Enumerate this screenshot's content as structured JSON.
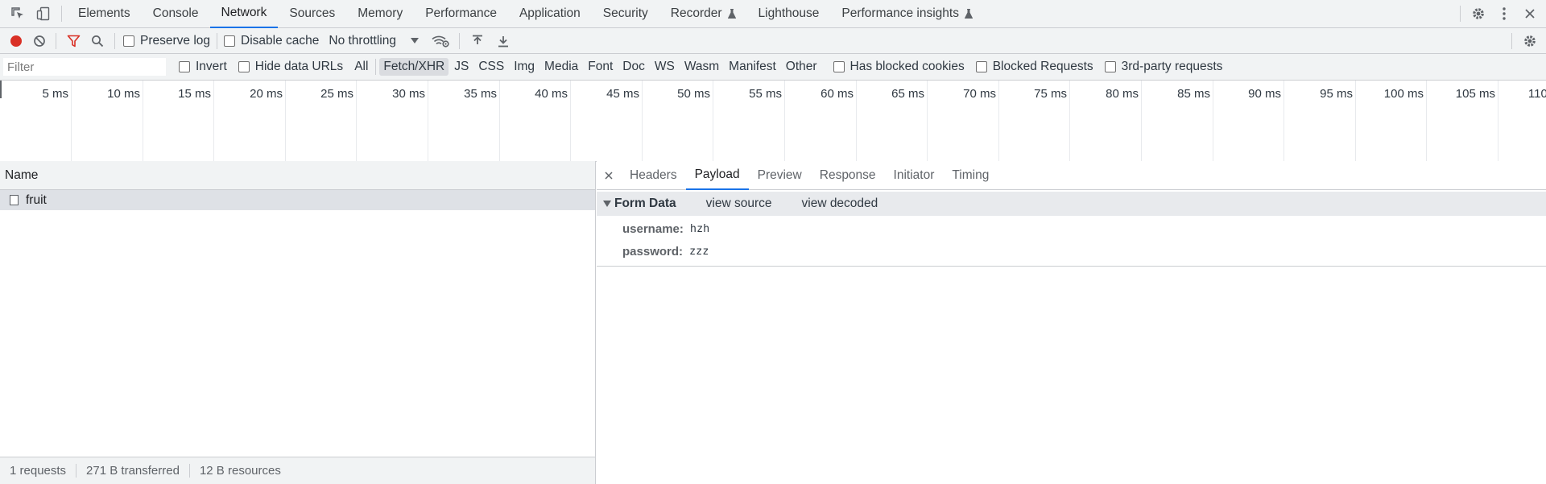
{
  "main_tabs": [
    {
      "label": "Elements",
      "active": false,
      "experimental": false
    },
    {
      "label": "Console",
      "active": false,
      "experimental": false
    },
    {
      "label": "Network",
      "active": true,
      "experimental": false
    },
    {
      "label": "Sources",
      "active": false,
      "experimental": false
    },
    {
      "label": "Memory",
      "active": false,
      "experimental": false
    },
    {
      "label": "Performance",
      "active": false,
      "experimental": false
    },
    {
      "label": "Application",
      "active": false,
      "experimental": false
    },
    {
      "label": "Security",
      "active": false,
      "experimental": false
    },
    {
      "label": "Recorder",
      "active": false,
      "experimental": true
    },
    {
      "label": "Lighthouse",
      "active": false,
      "experimental": false
    },
    {
      "label": "Performance insights",
      "active": false,
      "experimental": true
    }
  ],
  "toolbar": {
    "preserve_log": "Preserve log",
    "disable_cache": "Disable cache",
    "throttling": "No throttling"
  },
  "filterbar": {
    "placeholder": "Filter",
    "invert": "Invert",
    "hide_data_urls": "Hide data URLs",
    "types": [
      {
        "label": "All",
        "selected": false
      },
      {
        "label": "Fetch/XHR",
        "selected": true
      },
      {
        "label": "JS",
        "selected": false
      },
      {
        "label": "CSS",
        "selected": false
      },
      {
        "label": "Img",
        "selected": false
      },
      {
        "label": "Media",
        "selected": false
      },
      {
        "label": "Font",
        "selected": false
      },
      {
        "label": "Doc",
        "selected": false
      },
      {
        "label": "WS",
        "selected": false
      },
      {
        "label": "Wasm",
        "selected": false
      },
      {
        "label": "Manifest",
        "selected": false
      },
      {
        "label": "Other",
        "selected": false
      }
    ],
    "has_blocked_cookies": "Has blocked cookies",
    "blocked_requests": "Blocked Requests",
    "third_party": "3rd-party requests"
  },
  "timeline_ticks": [
    "5 ms",
    "10 ms",
    "15 ms",
    "20 ms",
    "25 ms",
    "30 ms",
    "35 ms",
    "40 ms",
    "45 ms",
    "50 ms",
    "55 ms",
    "60 ms",
    "65 ms",
    "70 ms",
    "75 ms",
    "80 ms",
    "85 ms",
    "90 ms",
    "95 ms",
    "100 ms",
    "105 ms",
    "110 ms"
  ],
  "requests": {
    "column_name": "Name",
    "rows": [
      {
        "name": "fruit"
      }
    ]
  },
  "status": {
    "requests": "1 requests",
    "transferred": "271 B transferred",
    "resources": "12 B resources"
  },
  "detail_tabs": [
    {
      "label": "Headers",
      "active": false
    },
    {
      "label": "Payload",
      "active": true
    },
    {
      "label": "Preview",
      "active": false
    },
    {
      "label": "Response",
      "active": false
    },
    {
      "label": "Initiator",
      "active": false
    },
    {
      "label": "Timing",
      "active": false
    }
  ],
  "payload": {
    "section_title": "Form Data",
    "view_source": "view source",
    "view_decoded": "view decoded",
    "fields": [
      {
        "key": "username:",
        "value": "hzh"
      },
      {
        "key": "password:",
        "value": "zzz"
      }
    ]
  },
  "colors": {
    "accent": "#1a73e8",
    "record": "#d93025",
    "filter_active": "#d93025",
    "toolbar_bg": "#f1f3f4"
  },
  "icons": {
    "inspect": "inspect-element-icon",
    "device": "device-toolbar-icon",
    "settings": "gear-icon",
    "more": "kebab-menu-icon",
    "close": "close-icon"
  }
}
